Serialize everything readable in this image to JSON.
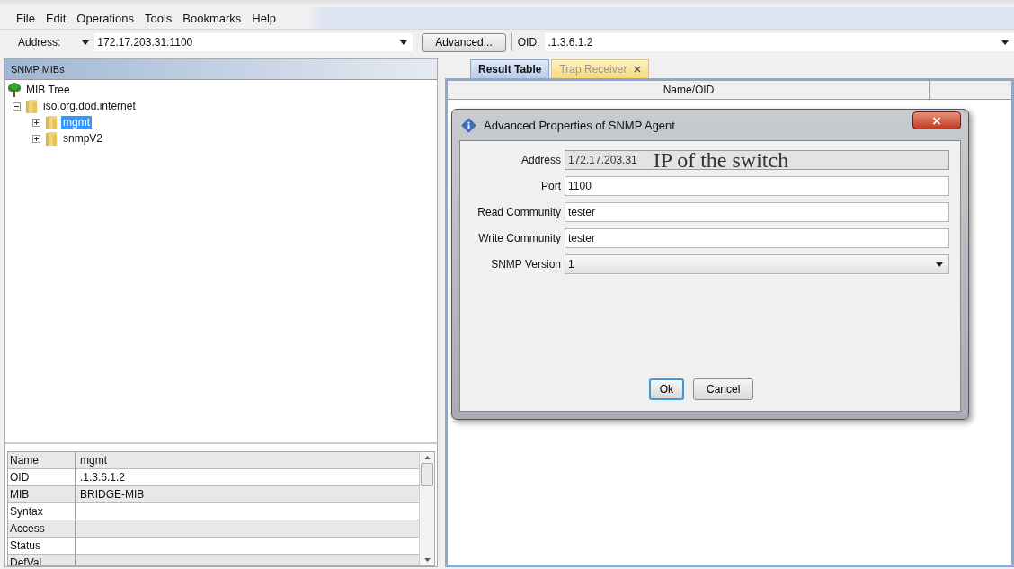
{
  "menu": [
    "File",
    "Edit",
    "Operations",
    "Tools",
    "Bookmarks",
    "Help"
  ],
  "toolbar": {
    "address_label": "Address:",
    "address_value": "172.17.203.31:1100",
    "advanced_button": "Advanced...",
    "oid_label": "OID:",
    "oid_value": ".1.3.6.1.2"
  },
  "left_panel": {
    "title": "SNMP MIBs",
    "tree": [
      {
        "label": "MIB Tree",
        "kind": "root",
        "selected": false,
        "children": [
          {
            "label": "iso.org.dod.internet",
            "kind": "folder",
            "expanded": true,
            "selected": false,
            "children": [
              {
                "label": "mgmt",
                "kind": "folder",
                "expanded": false,
                "selected": true
              },
              {
                "label": "snmpV2",
                "kind": "folder",
                "expanded": false,
                "selected": false
              }
            ]
          }
        ]
      }
    ],
    "properties": [
      {
        "name": "Name",
        "value": "mgmt"
      },
      {
        "name": "OID",
        "value": ".1.3.6.1.2"
      },
      {
        "name": "MIB",
        "value": "BRIDGE-MIB"
      },
      {
        "name": "Syntax"
      },
      {
        "name": "Access"
      },
      {
        "name": "Status"
      },
      {
        "name": "DefVal"
      }
    ]
  },
  "tabs": [
    {
      "label": "Result Table",
      "selected": true,
      "closable": false
    },
    {
      "label": "Trap Receiver",
      "selected": false,
      "closable": true
    }
  ],
  "result_table": {
    "columns": [
      "Name/OID"
    ]
  },
  "dialog": {
    "title": "Advanced Properties of SNMP Agent",
    "annotation": "IP of the switch",
    "fields": [
      {
        "label": "Address",
        "value": "172.17.203.31",
        "kind": "text",
        "disabled": true
      },
      {
        "label": "Port",
        "value": "1100",
        "kind": "text",
        "disabled": false
      },
      {
        "label": "Read Community",
        "value": "tester",
        "kind": "text",
        "disabled": false
      },
      {
        "label": "Write Community",
        "value": "tester",
        "kind": "text",
        "disabled": false
      },
      {
        "label": "SNMP Version",
        "value": "1",
        "kind": "select"
      }
    ],
    "buttons": [
      {
        "label": "Ok",
        "default": true
      },
      {
        "label": "Cancel",
        "default": false
      }
    ]
  }
}
